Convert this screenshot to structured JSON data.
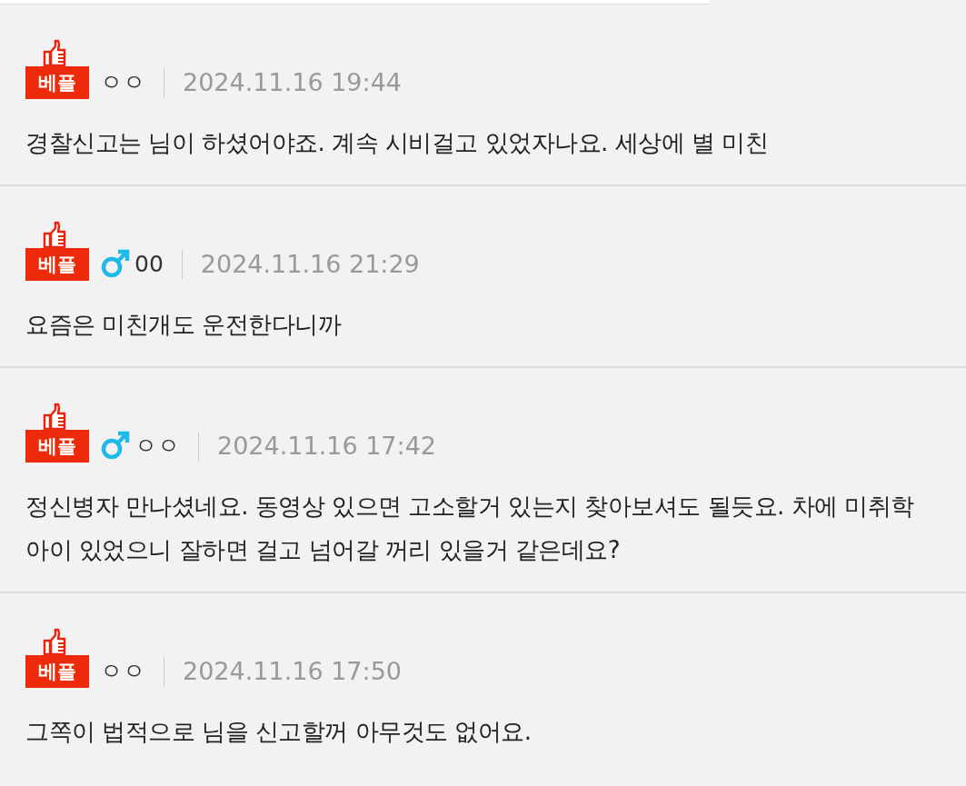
{
  "comments": [
    {
      "badge": "베플",
      "male": false,
      "author": "ㅇㅇ",
      "time": "2024.11.16 19:44",
      "text": "경찰신고는 님이 하셨어야죠. 계속 시비걸고 있었자나요. 세상에 별 미친"
    },
    {
      "badge": "베플",
      "male": true,
      "author": "00",
      "time": "2024.11.16 21:29",
      "text": "요즘은 미친개도 운전한다니까"
    },
    {
      "badge": "베플",
      "male": true,
      "author": "ㅇㅇ",
      "time": "2024.11.16 17:42",
      "text": "정신병자 만나셨네요. 동영상 있으면 고소할거 있는지 찾아보셔도 될듯요. 차에 미취학 아이 있었으니 잘하면 걸고 넘어갈 꺼리 있을거 같은데요?"
    },
    {
      "badge": "베플",
      "male": false,
      "author": "ㅇㅇ",
      "time": "2024.11.16 17:50",
      "text": "그쪽이 법적으로 님을 신고할꺼 아무것도 없어요."
    }
  ]
}
